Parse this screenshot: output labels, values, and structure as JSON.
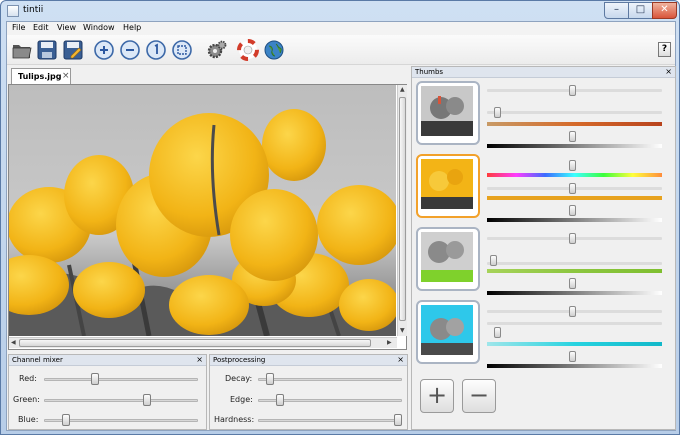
{
  "window": {
    "title": "tintii"
  },
  "menu": [
    "File",
    "Edit",
    "View",
    "Window",
    "Help"
  ],
  "toolbar": {
    "icons": [
      "open-icon",
      "save-icon",
      "save-as-icon",
      "zoom-in-icon",
      "zoom-out-icon",
      "zoom-1to1-icon",
      "zoom-fit-icon",
      "settings-icon",
      "help-lifebuoy-icon",
      "web-globe-icon"
    ],
    "help_label": "?"
  },
  "editor": {
    "tab_label": "Tulips.jpg",
    "tab_close": "×"
  },
  "channel_mixer": {
    "title": "Channel mixer",
    "close": "×",
    "sliders": [
      {
        "label": "Red:",
        "value": 0.32
      },
      {
        "label": "Green:",
        "value": 0.68
      },
      {
        "label": "Blue:",
        "value": 0.12
      }
    ]
  },
  "postprocessing": {
    "title": "Postprocessing",
    "close": "×",
    "sliders": [
      {
        "label": "Decay:",
        "value": 0.06
      },
      {
        "label": "Edge:",
        "value": 0.13
      },
      {
        "label": "Hardness:",
        "value": 1.0
      }
    ]
  },
  "thumbs": {
    "title": "Thumbs",
    "close": "×",
    "add_label": "+",
    "remove_label": "−",
    "items": [
      {
        "selected": false,
        "accent": "#e0722e",
        "hue": 0.49,
        "range": 0.04,
        "gain": 0.49
      },
      {
        "selected": true,
        "accent": "#f1b21d",
        "hue": 0.49,
        "range": 0.49,
        "gain": 0.49
      },
      {
        "selected": false,
        "accent": "#9acd32",
        "hue": 0.49,
        "range": 0.02,
        "gain": 0.49
      },
      {
        "selected": false,
        "accent": "#27d3e0",
        "hue": 0.49,
        "range": 0.04,
        "gain": 0.49
      }
    ]
  }
}
